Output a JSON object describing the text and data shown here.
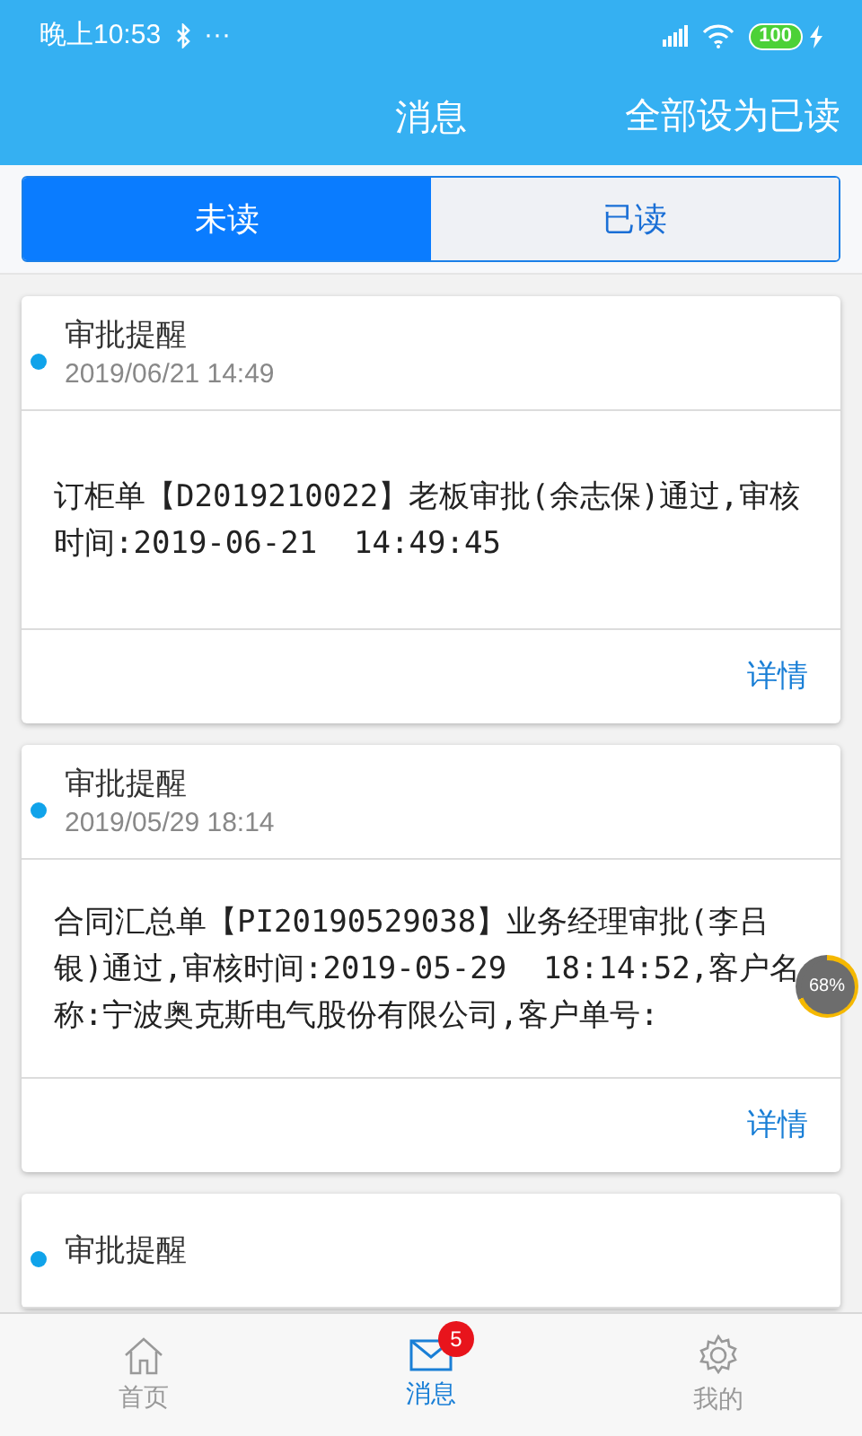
{
  "status_bar": {
    "time": "晚上10:53",
    "extra": "···",
    "battery": "100"
  },
  "header": {
    "title": "消息",
    "action": "全部设为已读"
  },
  "tabs": [
    {
      "label": "未读",
      "selected": true
    },
    {
      "label": "已读",
      "selected": false
    }
  ],
  "messages": [
    {
      "title": "审批提醒",
      "time": "2019/06/21 14:49",
      "unread": true,
      "body": "订柜单【D2019210022】老板审批(余志保)通过,审核时间:2019-06-21  14:49:45",
      "link": "详情"
    },
    {
      "title": "审批提醒",
      "time": "2019/05/29 18:14",
      "unread": true,
      "body": "合同汇总单【PI20190529038】业务经理审批(李吕银)通过,审核时间:2019-05-29  18:14:52,客户名称:宁波奥克斯电气股份有限公司,客户单号:",
      "link": "详情"
    },
    {
      "title": "审批提醒",
      "unread": true
    }
  ],
  "floating_meter": {
    "reading": "68%"
  },
  "bottom_nav": [
    {
      "label": "首页",
      "kind": "home",
      "selected": false
    },
    {
      "label": "消息",
      "kind": "mail",
      "selected": true,
      "badge": "5"
    },
    {
      "label": "我的",
      "kind": "gear",
      "selected": false
    }
  ]
}
